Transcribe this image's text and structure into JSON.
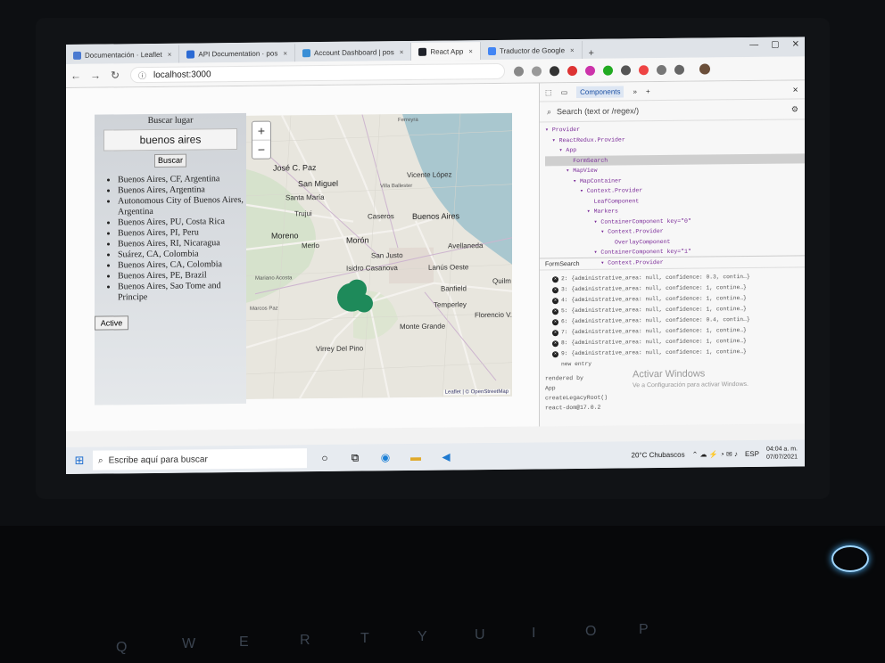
{
  "browser": {
    "tabs": [
      {
        "label": "Documentación · Leaflet",
        "active": false
      },
      {
        "label": "API Documentation · pos",
        "active": false
      },
      {
        "label": "Account Dashboard | pos",
        "active": false
      },
      {
        "label": "React App",
        "active": true
      },
      {
        "label": "Traductor de Google",
        "active": false
      }
    ],
    "url": "localhost:3000"
  },
  "search_panel": {
    "title": "Buscar lugar",
    "input_value": "buenos aires",
    "search_button": "Buscar",
    "results": [
      "Buenos Aires, CF, Argentina",
      "Buenos Aires, Argentina",
      "Autonomous City of Buenos Aires, Argentina",
      "Buenos Aires, PU, Costa Rica",
      "Buenos Aires, PI, Peru",
      "Buenos Aires, RI, Nicaragua",
      "Suárez, CA, Colombia",
      "Buenos Aires, CA, Colombia",
      "Buenos Aires, PE, Brazil",
      "Buenos Aires, Sao Tome and Principe"
    ],
    "active_button": "Active"
  },
  "map": {
    "zoom_in": "+",
    "zoom_out": "−",
    "attribution": "Leaflet | © OpenStreetMap",
    "labels": [
      {
        "text": "Ferreyra",
        "cls": "small"
      },
      {
        "text": "José C. Paz",
        "cls": "big"
      },
      {
        "text": "San Miguel",
        "cls": "big"
      },
      {
        "text": "Santa María",
        "cls": ""
      },
      {
        "text": "Trujui",
        "cls": ""
      },
      {
        "text": "Moreno",
        "cls": "big"
      },
      {
        "text": "Merlo",
        "cls": ""
      },
      {
        "text": "Morón",
        "cls": "big"
      },
      {
        "text": "Caseros",
        "cls": ""
      },
      {
        "text": "Buenos Aires",
        "cls": "big"
      },
      {
        "text": "Vicente López",
        "cls": ""
      },
      {
        "text": "Villa Ballester",
        "cls": "small"
      },
      {
        "text": "San Justo",
        "cls": ""
      },
      {
        "text": "Avellaneda",
        "cls": ""
      },
      {
        "text": "Isidro Casanova",
        "cls": ""
      },
      {
        "text": "Lanús Oeste",
        "cls": ""
      },
      {
        "text": "Banfield",
        "cls": ""
      },
      {
        "text": "Temperley",
        "cls": ""
      },
      {
        "text": "Monte Grande",
        "cls": ""
      },
      {
        "text": "Virrey Del Pino",
        "cls": ""
      },
      {
        "text": "Marcos Paz",
        "cls": "small"
      },
      {
        "text": "Florencio V.",
        "cls": ""
      },
      {
        "text": "Quilm",
        "cls": ""
      },
      {
        "text": "Mariano Acosta",
        "cls": "small"
      }
    ]
  },
  "devtools": {
    "tabs": [
      "Components",
      "»",
      "+"
    ],
    "search_placeholder": "Search (text or /regex/)",
    "tree": [
      "▾ Provider",
      "  ▾ ReactRedux.Provider",
      "    ▾ App",
      "        FormSearch",
      "      ▾ MapView",
      "        ▾ MapContainer",
      "          ▾ Context.Provider",
      "              LeafComponent",
      "            ▾ Markers",
      "              ▾ ContainerComponent key=\"0\"",
      "                ▾ Context.Provider",
      "                    OverlayComponent",
      "              ▾ ContainerComponent key=\"1\"",
      "                ▾ Context.Provider"
    ],
    "selected_component": "FormSearch",
    "props": [
      "2: {administrative_area: null, confidence: 0.3, contin…}",
      "3: {administrative_area: null, confidence: 1, contine…}",
      "4: {administrative_area: null, confidence: 1, contine…}",
      "5: {administrative_area: null, confidence: 1, contine…}",
      "6: {administrative_area: null, confidence: 0.4, contin…}",
      "7: {administrative_area: null, confidence: 1, contine…}",
      "8: {administrative_area: null, confidence: 1, contine…}",
      "9: {administrative_area: null, confidence: 1, contine…}",
      "new entry"
    ],
    "rendered_by": [
      "rendered by",
      "App",
      "createLegacyRoot()",
      "react-dom@17.0.2"
    ],
    "watermark_title": "Activar Windows",
    "watermark_sub": "Ve a Configuración para activar Windows."
  },
  "taskbar": {
    "search_placeholder": "Escribe aquí para buscar",
    "weather": "20°C  Chubascos",
    "language": "ESP",
    "time": "04:04 a. m.",
    "date": "07/07/2021"
  },
  "colors": {
    "marker": "#1e8a5a",
    "devtools_badge": "#d8c14a"
  }
}
